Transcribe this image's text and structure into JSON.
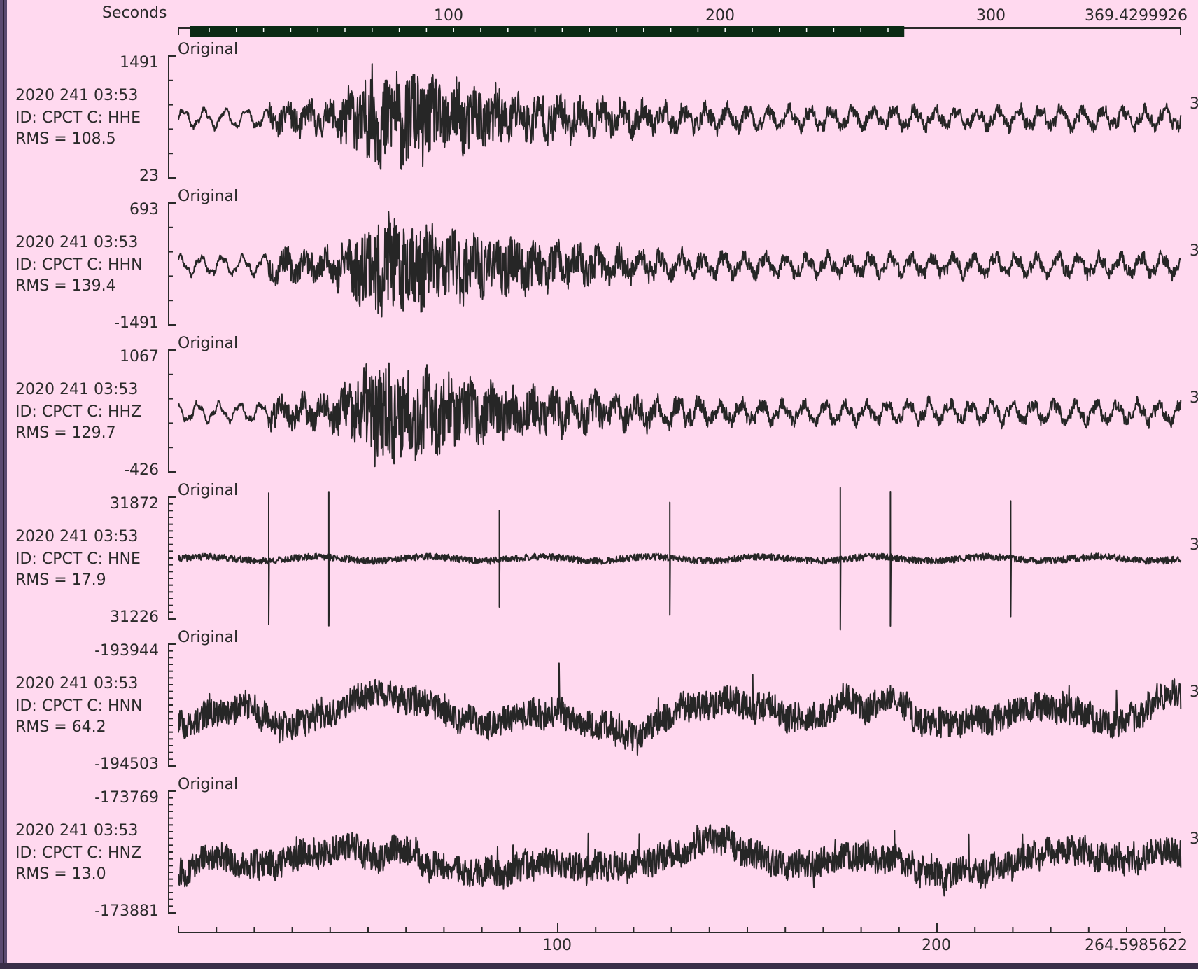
{
  "colors": {
    "background": "#ffd9ef",
    "trace": "#262626",
    "scroll_bar": "#0b2a14",
    "frame": "#5b4a70"
  },
  "top_axis": {
    "unit_label": "Seconds",
    "tick_labels": [
      "100",
      "200",
      "300"
    ],
    "end_value": "369.4299926"
  },
  "scroll_bar": {
    "start_fraction": 0.0,
    "end_fraction": 0.72
  },
  "bottom_axis": {
    "tick_labels": [
      "100",
      "200"
    ],
    "end_value": "264.5985622"
  },
  "panels": [
    {
      "tag": "Original",
      "max": "1491",
      "min": "23",
      "date": "2020 241 03:53",
      "id": "ID: CPCT C: HHE",
      "rms": "RMS = 108.5",
      "right_tag": "3",
      "style": "event",
      "seed": 11
    },
    {
      "tag": "Original",
      "max": "693",
      "min": "-1491",
      "date": "2020 241 03:53",
      "id": "ID: CPCT C: HHN",
      "rms": "RMS = 139.4",
      "right_tag": "3",
      "style": "event",
      "seed": 23
    },
    {
      "tag": "Original",
      "max": "1067",
      "min": "-426",
      "date": "2020 241 03:53",
      "id": "ID: CPCT C: HHZ",
      "rms": "RMS = 129.7",
      "right_tag": "3",
      "style": "event",
      "seed": 37
    },
    {
      "tag": "Original",
      "max": "31872",
      "min": "31226",
      "date": "2020 241 03:53",
      "id": "ID: CPCT C: HNE",
      "rms": "RMS = 17.9",
      "right_tag": "3",
      "style": "spikes",
      "seed": 41
    },
    {
      "tag": "Original",
      "max": "-193944",
      "min": "-194503",
      "date": "2020 241 03:53",
      "id": "ID: CPCT C: HNN",
      "rms": "RMS = 64.2",
      "right_tag": "3",
      "style": "noise",
      "seed": 53
    },
    {
      "tag": "Original",
      "max": "-173769",
      "min": "-173881",
      "date": "2020 241 03:53",
      "id": "ID: CPCT C: HNZ",
      "rms": "RMS = 13.0",
      "right_tag": "3",
      "style": "noise",
      "seed": 67
    }
  ]
}
